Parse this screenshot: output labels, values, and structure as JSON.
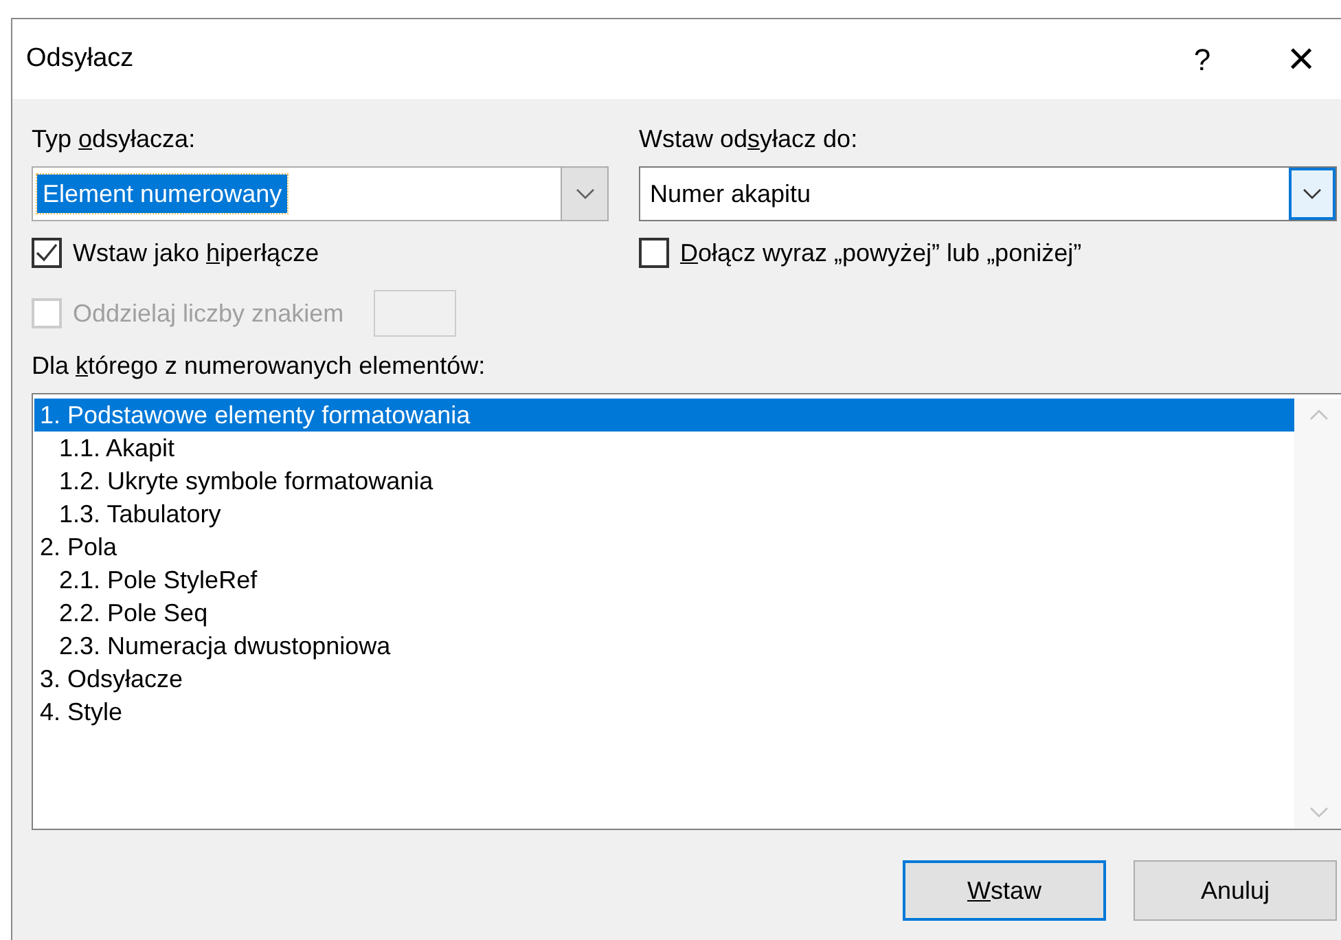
{
  "window": {
    "title": "Odsyłacz",
    "help": "?",
    "close": "×"
  },
  "reference_type": {
    "label": {
      "pre": "Typ ",
      "key": "o",
      "post": "dsyłacza:"
    },
    "value": "Element numerowany",
    "focused": true
  },
  "insert_reference_to": {
    "label": {
      "pre": "Wstaw od",
      "key": "s",
      "post": "yłacz do:"
    },
    "value": "Numer akapitu",
    "focused": false
  },
  "checkboxes": [
    {
      "label": {
        "pre": "Wstaw jako ",
        "key": "h",
        "post": "iperłącze"
      },
      "checked": true,
      "disabled": false
    },
    {
      "label": {
        "key": "D",
        "post": "ołącz wyraz „powyżej” lub „poniżej”"
      },
      "checked": false,
      "disabled": false
    },
    {
      "label": {
        "pre": "Oddzielaj liczby znakiem"
      },
      "checked": false,
      "disabled": true
    }
  ],
  "list_label": {
    "pre": "Dla ",
    "key": "k",
    "post": "tórego z numerowanych elementów:"
  },
  "items": [
    {
      "text": "1. Podstawowe elementy formatowania",
      "selected": true,
      "children": [
        {
          "text": "1.1. Akapit",
          "selected": false
        },
        {
          "text": "1.2. Ukryte symbole formatowania",
          "selected": false
        },
        {
          "text": "1.3. Tabulatory",
          "selected": false
        }
      ]
    },
    {
      "text": "2. Pola",
      "selected": false,
      "children": [
        {
          "text": "2.1. Pole StyleRef",
          "selected": false
        },
        {
          "text": "2.2. Pole Seq",
          "selected": false
        },
        {
          "text": "2.3. Numeracja dwustopniowa",
          "selected": false
        }
      ]
    },
    {
      "text": "3. Odsyłacze",
      "selected": false
    },
    {
      "text": "4. Style",
      "selected": false
    }
  ],
  "buttons": [
    {
      "label": {
        "key": "W",
        "post": "staw"
      },
      "default": true
    },
    {
      "label": {
        "pre": "Anuluj"
      },
      "default": false
    }
  ]
}
